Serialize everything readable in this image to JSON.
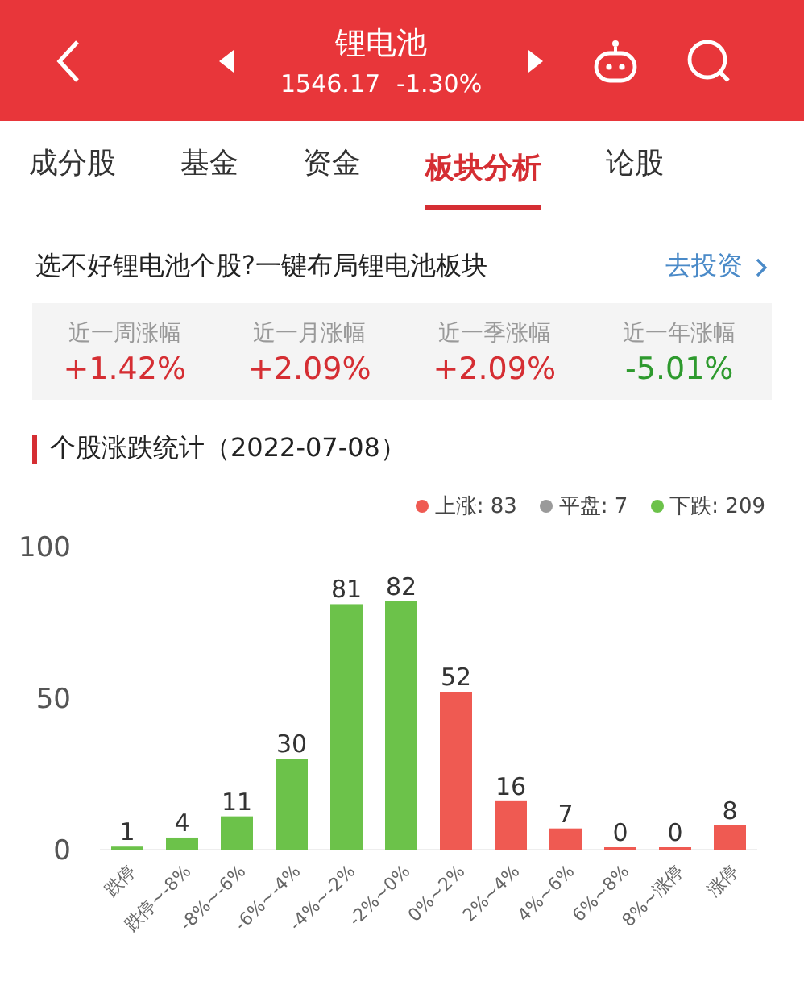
{
  "header": {
    "title": "锂电池",
    "price": "1546.17",
    "change": "-1.30%"
  },
  "tabs": [
    {
      "label": "成分股",
      "selected": false
    },
    {
      "label": "基金",
      "selected": false
    },
    {
      "label": "资金",
      "selected": false
    },
    {
      "label": "板块分析",
      "selected": true
    },
    {
      "label": "论股",
      "selected": false
    }
  ],
  "promo": {
    "text": "选不好锂电池个股?一键布局锂电池板块",
    "link": "去投资"
  },
  "returns": [
    {
      "label": "近一周涨幅",
      "value": "+1.42%",
      "kind": "rise"
    },
    {
      "label": "近一月涨幅",
      "value": "+2.09%",
      "kind": "rise"
    },
    {
      "label": "近一季涨幅",
      "value": "+2.09%",
      "kind": "rise"
    },
    {
      "label": "近一年涨幅",
      "value": "-5.01%",
      "kind": "fall"
    }
  ],
  "stats": {
    "title": "个股涨跌统计（2022-07-08）",
    "legend": [
      {
        "label": "上涨: 83",
        "color": "#ef5a52"
      },
      {
        "label": "平盘: 7",
        "color": "#9a9a9a"
      },
      {
        "label": "下跌: 209",
        "color": "#6cc24a"
      }
    ],
    "chart_data": {
      "type": "bar",
      "categories": [
        "跌停",
        "跌停~-8%",
        "-8%~-6%",
        "-6%~-4%",
        "-4%~-2%",
        "-2%~0%",
        "0%~2%",
        "2%~4%",
        "4%~6%",
        "6%~8%",
        "8%~涨停",
        "涨停"
      ],
      "series": [
        {
          "color": "#6cc24a",
          "values": [
            1,
            4,
            11,
            30,
            81,
            82,
            null,
            null,
            null,
            null,
            null,
            null
          ]
        },
        {
          "color": "#ef5a52",
          "values": [
            null,
            null,
            null,
            null,
            null,
            null,
            52,
            16,
            7,
            0,
            0,
            8
          ]
        }
      ],
      "ylim": [
        0,
        100
      ],
      "yticks": [
        0,
        50,
        100
      ],
      "stacked": true,
      "data_labels": true
    }
  }
}
